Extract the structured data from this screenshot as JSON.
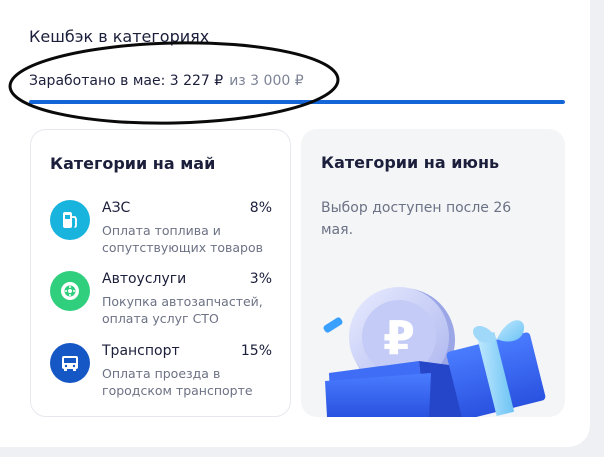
{
  "section_title": "Кешбэк в категориях",
  "earned": {
    "label": "Заработано в мае: 3 227 ₽",
    "limit": "из 3 000 ₽",
    "progress_fraction": 1.0
  },
  "may_card": {
    "title": "Категории на май",
    "categories": [
      {
        "name": "АЗС",
        "percent": "8%",
        "description": "Оплата топлива и сопутствующих товаров",
        "icon": "fuel-pump-icon",
        "color": "#19b4dd"
      },
      {
        "name": "Автоуслуги",
        "percent": "3%",
        "description": "Покупка автозапчастей, оплата услуг СТО",
        "icon": "wheel-icon",
        "color": "#2fcf7e"
      },
      {
        "name": "Транспорт",
        "percent": "15%",
        "description": "Оплата проезда в городском транспорте",
        "icon": "bus-icon",
        "color": "#1557c5"
      }
    ]
  },
  "june_card": {
    "title": "Категории на июнь",
    "note": "Выбор доступен после 26 мая."
  },
  "colors": {
    "accent": "#1466d8",
    "text": "#1b1f3b",
    "muted": "#6c7285"
  }
}
